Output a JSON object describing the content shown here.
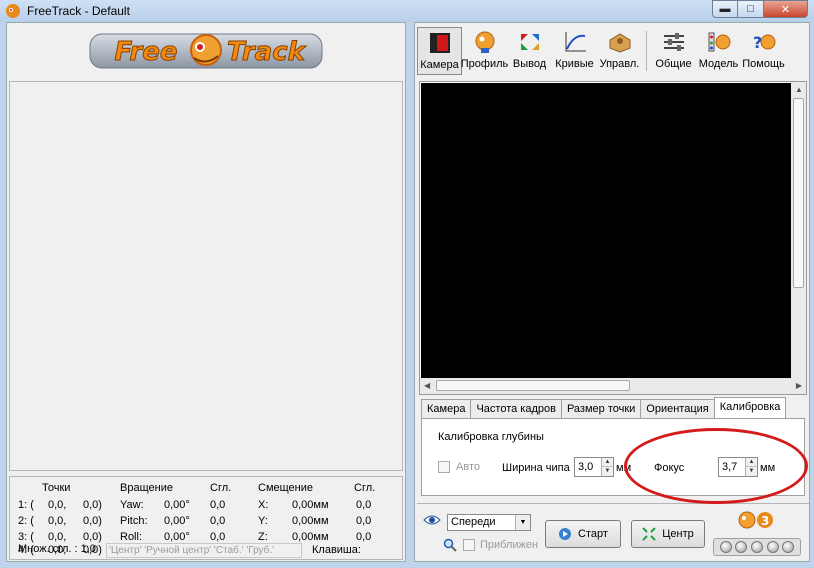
{
  "window": {
    "title": "FreeTrack - Default",
    "min_symbol": "▬",
    "max_symbol": "□",
    "close_symbol": "✕"
  },
  "logo": {
    "text": "FreeTrack",
    "icon": "freetrack-logo"
  },
  "stats": {
    "headers": {
      "points": "Точки",
      "rotation": "Вращение",
      "smooth1": "Сгл.",
      "offset": "Смещение",
      "smooth2": "Сгл."
    },
    "points": [
      {
        "label": "1: (",
        "x": "0,0,",
        "y": "0,0)"
      },
      {
        "label": "2: (",
        "x": "0,0,",
        "y": "0,0)"
      },
      {
        "label": "3: (",
        "x": "0,0,",
        "y": "0,0)"
      },
      {
        "label": "4: (",
        "x": "0,0,",
        "y": "0,0)"
      }
    ],
    "rotation": [
      {
        "axis": "Yaw:",
        "value": "0,00°",
        "smooth": "0,0"
      },
      {
        "axis": "Pitch:",
        "value": "0,00°",
        "smooth": "0,0"
      },
      {
        "axis": "Roll:",
        "value": "0,00°",
        "smooth": "0,0"
      }
    ],
    "offset": [
      {
        "axis": "X:",
        "value": "0,00мм",
        "smooth": "0,0"
      },
      {
        "axis": "Y:",
        "value": "0,00мм",
        "smooth": "0,0"
      },
      {
        "axis": "Z:",
        "value": "0,00мм",
        "smooth": "0,0"
      }
    ],
    "multiplier_label": "Множ. сгл. : 1,0",
    "hotkeys": "'Центр' 'Ручной центр' 'Стаб.' 'Груб.'",
    "key_label": "Клавиша:"
  },
  "toolbar": {
    "items": [
      {
        "label": "Камера",
        "icon": "camera-icon"
      },
      {
        "label": "Профиль",
        "icon": "profile-icon"
      },
      {
        "label": "Вывод",
        "icon": "output-icon"
      },
      {
        "label": "Кривые",
        "icon": "curves-icon"
      },
      {
        "label": "Управл.",
        "icon": "control-icon"
      },
      {
        "label": "Общие",
        "icon": "general-icon"
      },
      {
        "label": "Модель",
        "icon": "model-icon"
      },
      {
        "label": "Помощь",
        "icon": "help-icon"
      }
    ]
  },
  "tabs": [
    {
      "label": "Камера"
    },
    {
      "label": "Частота кадров"
    },
    {
      "label": "Размер точки"
    },
    {
      "label": "Ориентация"
    },
    {
      "label": "Калибровка"
    }
  ],
  "calibration": {
    "group_label": "Калибровка глубины",
    "auto_label": "Авто",
    "chip_width_label": "Ширина чипа",
    "chip_width_value": "3,0",
    "chip_unit": "мм",
    "focus_label": "Фокус",
    "focus_value": "3,7",
    "focus_unit": "мм"
  },
  "bottom": {
    "view_select": "Спереди",
    "zoom_label": "Приближение",
    "start_label": "Старт",
    "center_label": "Центр"
  },
  "colors": {
    "annotation": "#d41a1a",
    "video_bg": "#000000",
    "accent": "#e8891a"
  }
}
